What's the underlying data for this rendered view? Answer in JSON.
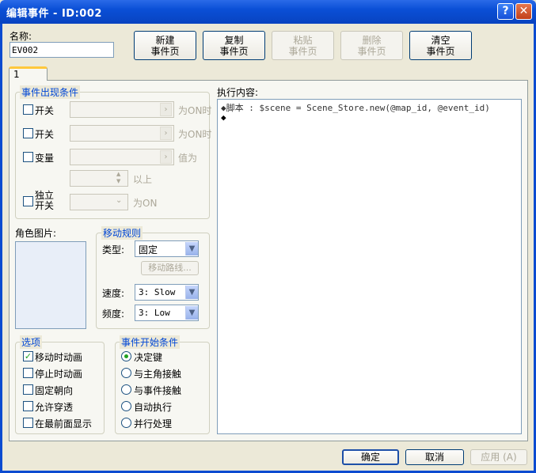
{
  "window": {
    "title": "编辑事件 - ID:002"
  },
  "name_field": {
    "label": "名称:",
    "value": "EV002"
  },
  "toolbar": {
    "new_page": [
      "新建",
      "事件页"
    ],
    "copy_page": [
      "复制",
      "事件页"
    ],
    "paste_page": [
      "粘贴",
      "事件页"
    ],
    "delete_page": [
      "删除",
      "事件页"
    ],
    "clear_page": [
      "清空",
      "事件页"
    ]
  },
  "tabs": [
    {
      "label": "1"
    }
  ],
  "conditions": {
    "title": "事件出现条件",
    "switch1": {
      "label": "开关",
      "suffix": "为ON时"
    },
    "switch2": {
      "label": "开关",
      "suffix": "为ON时"
    },
    "variable": {
      "label": "变量",
      "suffix": "值为"
    },
    "variable_above": "以上",
    "self_switch": {
      "label": [
        "独立",
        "开关"
      ],
      "suffix": "为ON"
    }
  },
  "graphic": {
    "label": "角色图片:"
  },
  "movement": {
    "title": "移动规则",
    "type_label": "类型:",
    "type_value": "固定",
    "route_button": "移动路线...",
    "speed_label": "速度:",
    "speed_value": "3: Slow",
    "freq_label": "频度:",
    "freq_value": "3: Low"
  },
  "options": {
    "title": "选项",
    "items": [
      {
        "label": "移动时动画",
        "checked": true
      },
      {
        "label": "停止时动画",
        "checked": false
      },
      {
        "label": "固定朝向",
        "checked": false
      },
      {
        "label": "允许穿透",
        "checked": false
      },
      {
        "label": "在最前面显示",
        "checked": false
      }
    ]
  },
  "trigger": {
    "title": "事件开始条件",
    "items": [
      {
        "label": "决定键",
        "selected": true
      },
      {
        "label": "与主角接触",
        "selected": false
      },
      {
        "label": "与事件接触",
        "selected": false
      },
      {
        "label": "自动执行",
        "selected": false
      },
      {
        "label": "并行处理",
        "selected": false
      }
    ]
  },
  "contents": {
    "label": "执行内容:",
    "lines": [
      "◆脚本 : $scene = Scene_Store.new(@map_id, @event_id)",
      "◆"
    ]
  },
  "footer": {
    "ok": "确定",
    "cancel": "取消",
    "apply": "应用 (A)"
  }
}
